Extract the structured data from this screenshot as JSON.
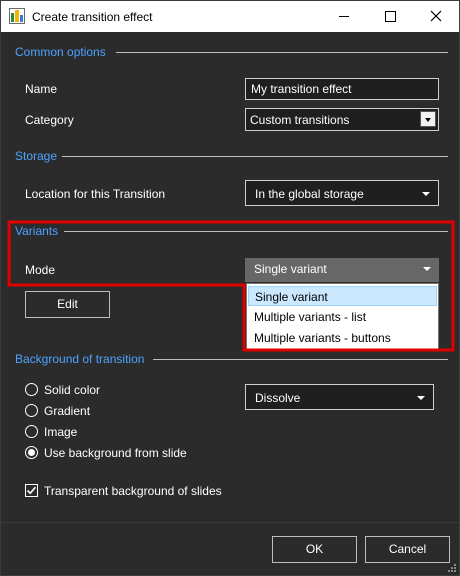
{
  "window": {
    "title": "Create transition effect",
    "title_buttons": [
      "minimize",
      "maximize",
      "close"
    ]
  },
  "common_options": {
    "heading": "Common options",
    "name_label": "Name",
    "name_value": "My transition effect",
    "category_label": "Category",
    "category_value": "Custom transitions"
  },
  "storage": {
    "heading": "Storage",
    "location_label": "Location for this Transition",
    "location_value": "In the global storage"
  },
  "variants": {
    "heading": "Variants",
    "mode_label": "Mode",
    "mode_value": "Single variant",
    "edit_button": "Edit",
    "mode_options": [
      "Single variant",
      "Multiple variants - list",
      "Multiple variants - buttons"
    ],
    "selected_option_index": 0
  },
  "background": {
    "heading": "Background of transition",
    "options": [
      "Solid color",
      "Gradient",
      "Image",
      "Use background from slide"
    ],
    "selected_index": 3,
    "effect_value": "Dissolve",
    "transparent_label": "Transparent background of slides",
    "transparent_checked": true
  },
  "footer": {
    "ok_label": "OK",
    "cancel_label": "Cancel"
  },
  "colors": {
    "section_heading": "#4da3ff",
    "highlight_box": "#e00000",
    "dropdown_selected": "#cce8ff"
  }
}
